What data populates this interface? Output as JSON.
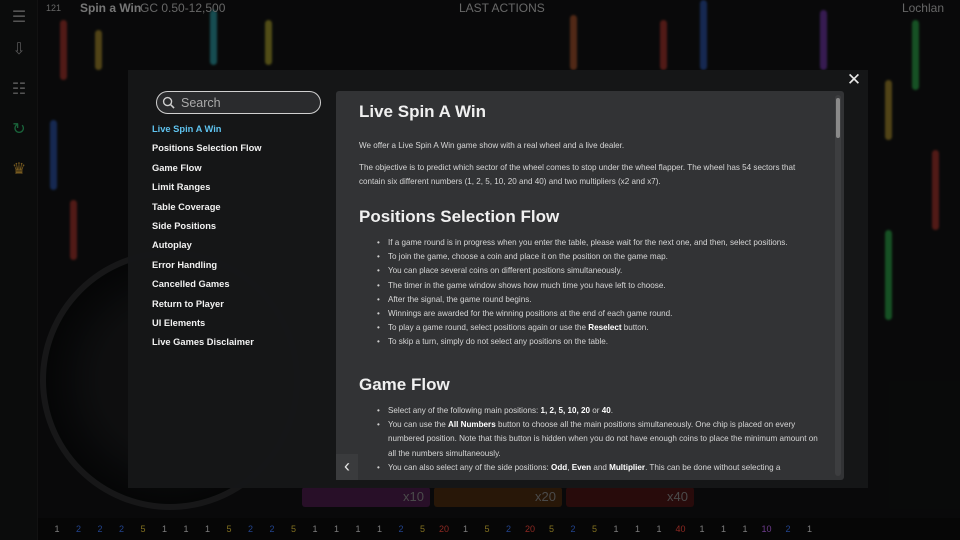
{
  "header": {
    "balance": "121",
    "game_name": "Spin a Win",
    "limits": "GC 0.50-12,500",
    "last_actions": "LAST ACTIONS",
    "player": "Lochlan"
  },
  "search": {
    "placeholder": "Search"
  },
  "nav": {
    "items": [
      "Live Spin A Win",
      "Positions Selection Flow",
      "Game Flow",
      "Limit Ranges",
      "Table Coverage",
      "Side Positions",
      "Autoplay",
      "Error Handling",
      "Cancelled Games",
      "Return to Player",
      "UI Elements",
      "Live Games Disclaimer"
    ],
    "active_index": 0
  },
  "content": {
    "title": "Live Spin A Win",
    "intro": "We offer a Live Spin A Win game show with a real wheel and a live dealer.",
    "objective": "The objective is to predict which sector of the wheel comes to stop under the wheel flapper. The wheel has 54 sectors that contain six different numbers (1, 2, 5, 10, 20 and 40) and two multipliers (x2 and x7).",
    "section2_title": "Positions Selection Flow",
    "section2_bullets": [
      "If a game round is in progress when you enter the table, please wait for the next one, and then, select positions.",
      "To join the game, choose a coin and place it on the position on the game map.",
      "You can place several coins on different positions simultaneously.",
      "The timer in the game window shows how much time you have left to choose.",
      "After the signal, the game round begins.",
      "Winnings are awarded for the winning positions at the end of each game round."
    ],
    "reselect_pre": "To play a game round, select positions again or use the ",
    "reselect_bold": "Reselect",
    "reselect_post": " button.",
    "skip_turn": "To skip a turn, simply do not select any positions on the table.",
    "section3_title": "Game Flow",
    "gf1_pre": "Select any of the following main positions: ",
    "gf1_positions": "1, 2, 5, 10, 20",
    "gf1_or": " or ",
    "gf1_last": "40",
    "gf1_end": ".",
    "gf2_pre": "You can use the ",
    "gf2_bold": "All Numbers",
    "gf2_post": " button to choose all the main positions simultaneously. One chip is placed on every numbered position. Note that this button is hidden when you do not have enough coins to place the minimum amount on all the numbers simultaneously.",
    "gf3_pre": "You can also select any of the side positions: ",
    "gf3_odd": "Odd",
    "gf3_comma": ", ",
    "gf3_even": "Even",
    "gf3_and": " and ",
    "gf3_mult": "Multiplier",
    "gf3_post": ". This can be done without selecting a"
  },
  "bet_pills": [
    "x10",
    "x20",
    "x40"
  ],
  "history": [
    "1",
    "2",
    "2",
    "2",
    "5",
    "1",
    "1",
    "1",
    "5",
    "2",
    "2",
    "5",
    "1",
    "1",
    "1",
    "1",
    "2",
    "5",
    "20",
    "1",
    "5",
    "2",
    "20",
    "5",
    "2",
    "5",
    "1",
    "1",
    "1",
    "40",
    "1",
    "1",
    "1",
    "10",
    "2",
    "1"
  ],
  "colors": {
    "accent": "#5fc3ef",
    "modal_bg": "#161718",
    "content_bg": "#323335"
  }
}
